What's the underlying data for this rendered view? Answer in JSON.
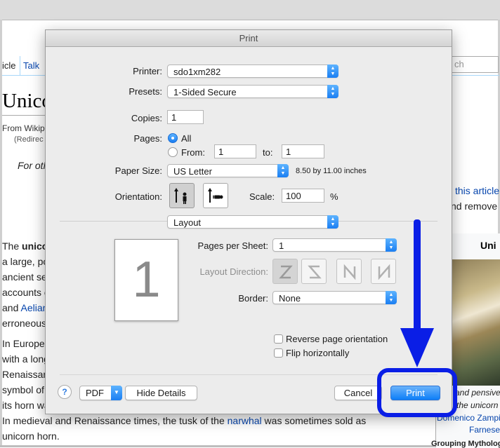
{
  "background": {
    "tabs": [
      "icle",
      "Talk"
    ],
    "search_placeholder": "ch",
    "title": "Unico",
    "from": "From Wikip",
    "redirect": "(Redirec",
    "hatnote": "For oth",
    "right_link": "this article",
    "right_text": "nd remove",
    "infobox_title": "Uni",
    "infobox_caption": [
      "and pensive",
      "the unicorn",
      "Domenico Zampie",
      "Farnese"
    ],
    "infobox_row": "Grouping   Mythology",
    "paragraphs": [
      {
        "pre": "The ",
        "bold": "unico",
        "post": ""
      },
      {
        "text": "a large, po"
      },
      {
        "text": "ancient se"
      },
      {
        "text": "accounts c"
      },
      {
        "pre": "and ",
        "link": "Aelian",
        "post": ""
      },
      {
        "text": "erroneous"
      },
      {
        "text": "In Europe"
      },
      {
        "text": "with a long"
      },
      {
        "link": "Renaissan"
      },
      {
        "text": "symbol of"
      },
      {
        "text": "its horn wa"
      }
    ],
    "bottom_line1": {
      "pre": "In medieval and Renaissance times, the tusk of the ",
      "link": "narwhal",
      "post": " was sometimes sold as"
    },
    "bottom_line2": "unicorn horn."
  },
  "dialog": {
    "title": "Print",
    "printer_label": "Printer:",
    "printer_value": "sdo1xm282",
    "presets_label": "Presets:",
    "presets_value": "1-Sided Secure",
    "copies_label": "Copies:",
    "copies_value": "1",
    "pages_label": "Pages:",
    "pages_all": "All",
    "pages_from": "From:",
    "from_value": "1",
    "to_label": "to:",
    "to_value": "1",
    "paper_label": "Paper Size:",
    "paper_value": "US Letter",
    "paper_dims": "8.50 by 11.00 inches",
    "orientation_label": "Orientation:",
    "scale_label": "Scale:",
    "scale_value": "100",
    "scale_unit": "%",
    "section_value": "Layout",
    "preview_number": "1",
    "pps_label": "Pages per Sheet:",
    "pps_value": "1",
    "layout_dir_label": "Layout Direction:",
    "border_label": "Border:",
    "border_value": "None",
    "reverse_label": "Reverse page orientation",
    "flip_label": "Flip horizontally",
    "help_label": "?",
    "pdf_label": "PDF",
    "hide_details_label": "Hide Details",
    "cancel_label": "Cancel",
    "print_label": "Print"
  },
  "colors": {
    "accent": "#1a7ef2",
    "annotation": "#0a1ee6",
    "link": "#0645ad"
  }
}
